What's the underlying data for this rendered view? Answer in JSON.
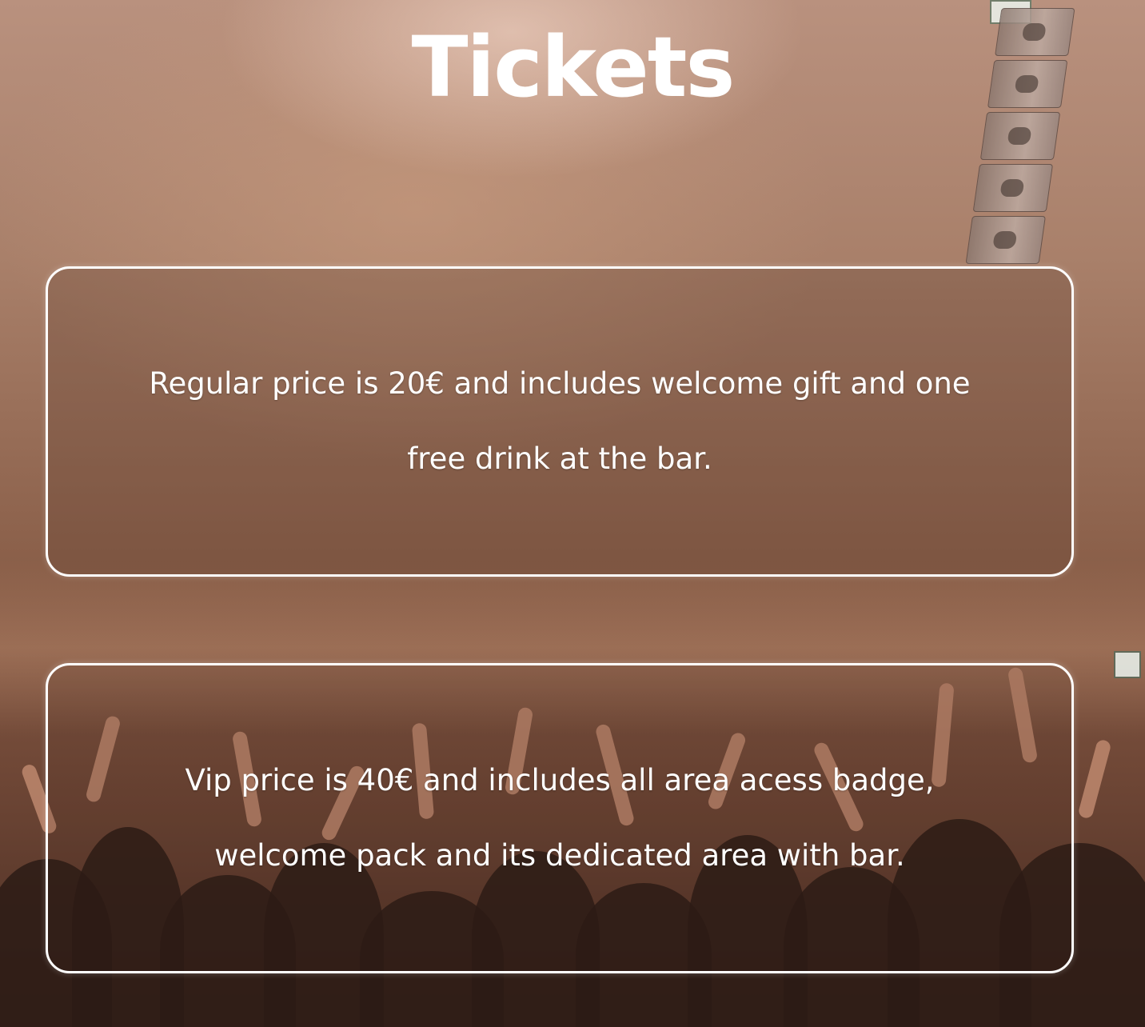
{
  "page": {
    "title": "Tickets"
  },
  "tickets": [
    {
      "kind": "regular",
      "description": "Regular price is 20€ and includes welcome gift and one free drink at the bar."
    },
    {
      "kind": "vip",
      "description": "Vip price is 40€ and includes all area acess badge, welcome pack and its dedicated area with bar."
    }
  ],
  "colors": {
    "text": "#ffffff",
    "card_border": "#ffffff",
    "background_tone": "#8a5f49"
  }
}
